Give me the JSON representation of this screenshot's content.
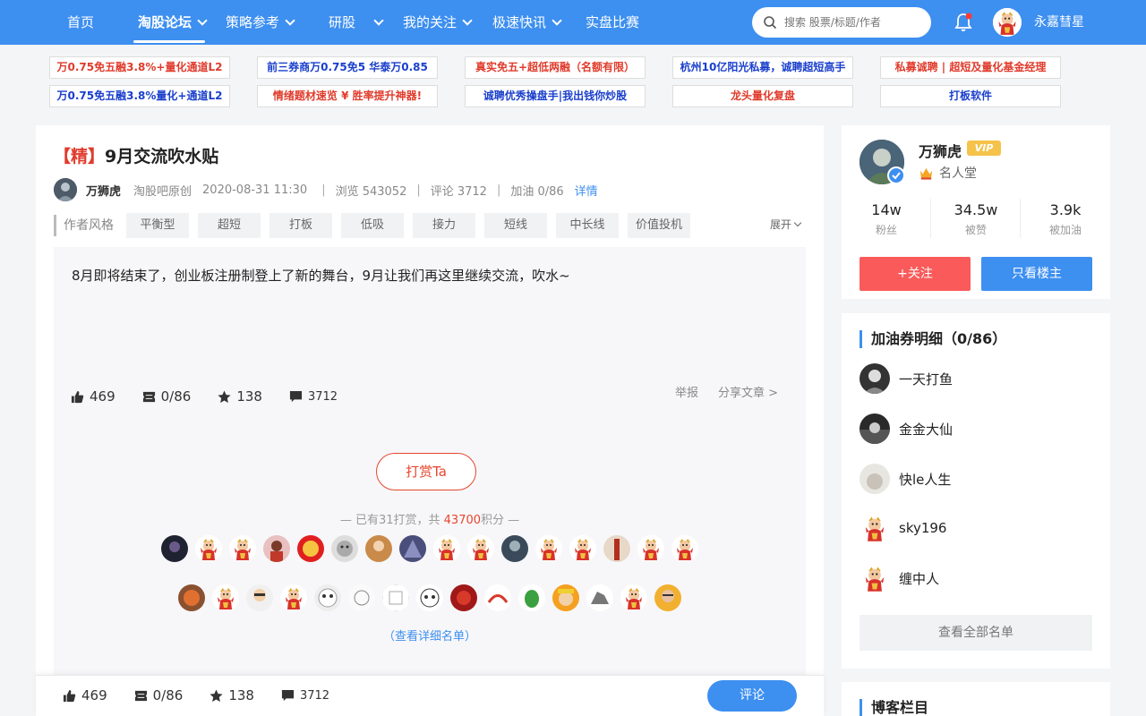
{
  "nav": {
    "items": [
      "首页",
      "淘股论坛",
      "策略参考",
      "研股",
      "我的关注",
      "极速快讯",
      "实盘比赛"
    ],
    "search_placeholder": "搜索 股票/标题/作者",
    "username": "永嘉彗星"
  },
  "ads": [
    {
      "text": "万0.75免五融3.8%+量化通道L2",
      "color": "red"
    },
    {
      "text": "前三券商万0.75免5 华泰万0.85",
      "color": "blue"
    },
    {
      "text": "真实免五+超低两融（名额有限）",
      "color": "red"
    },
    {
      "text": "杭州10亿阳光私募，诚聘超短高手",
      "color": "blue"
    },
    {
      "text": "私募诚聘 | 超短及量化基金经理",
      "color": "red"
    },
    {
      "text": "万0.75免五融3.8%量化+通道L2",
      "color": "blue"
    },
    {
      "text": "情绪题材速览 ¥ 胜率提升神器!",
      "color": "red"
    },
    {
      "text": "诚聘优秀操盘手|我出钱你炒股",
      "color": "blue"
    },
    {
      "text": "龙头量化复盘",
      "color": "red"
    },
    {
      "text": "打板软件",
      "color": "blue"
    }
  ],
  "post": {
    "tag": "【精】",
    "title": "9月交流吹水贴",
    "author": "万狮虎",
    "source": "淘股吧原创",
    "datetime": "2020-08-31 11:30",
    "views": "浏览 543052",
    "comments_meta": "评论 3712",
    "fuel_meta": "加油 0/86",
    "detail_link": "详情",
    "style_label": "作者风格",
    "styles": [
      "平衡型",
      "超短",
      "打板",
      "低吸",
      "接力",
      "短线",
      "中长线",
      "价值投机"
    ],
    "expand": "展开",
    "content": "8月即将结束了，创业板注册制登上了新的舞台，9月让我们再这里继续交流，吹水~"
  },
  "stats": {
    "likes": "469",
    "fuel": "0/86",
    "stars": "138",
    "comments": "3712",
    "report": "举报",
    "share": "分享文章 >"
  },
  "tip": {
    "button": "打赏Ta",
    "prefix": "— 已有31打赏，共 ",
    "amount": "43700",
    "suffix": "积分 —",
    "view_list": "（查看详细名单）"
  },
  "bottom": {
    "comment_button": "评论"
  },
  "profile": {
    "name": "万狮虎",
    "vip": "VIP",
    "hall": "名人堂",
    "stats": [
      {
        "value": "14w",
        "label": "粉丝"
      },
      {
        "value": "34.5w",
        "label": "被赞"
      },
      {
        "value": "3.9k",
        "label": "被加油"
      }
    ],
    "follow": "+关注",
    "owner_only": "只看楼主"
  },
  "fuel_detail": {
    "title": "加油券明细（0/86）",
    "users": [
      "一天打鱼",
      "金金大仙",
      "快le人生",
      "sky196",
      "缠中人"
    ],
    "view_all": "查看全部名单"
  },
  "blog_column": {
    "title": "博客栏目"
  },
  "colors": {
    "brand": "#3d8ff0",
    "accent_red": "#e8452f",
    "follow_red": "#fa5a5a",
    "vip_gold": "#f5c34a"
  }
}
